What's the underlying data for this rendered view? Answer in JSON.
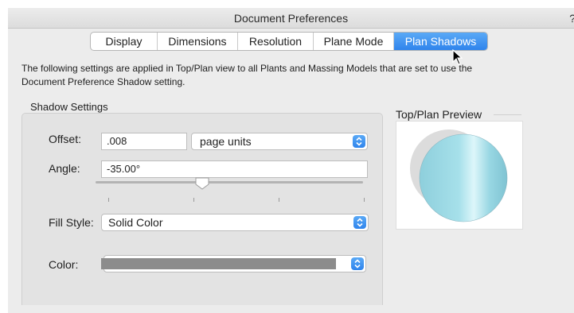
{
  "window": {
    "title": "Document Preferences",
    "help": "?"
  },
  "tabs": [
    {
      "label": "Display",
      "active": false
    },
    {
      "label": "Dimensions",
      "active": false
    },
    {
      "label": "Resolution",
      "active": false
    },
    {
      "label": "Plane Mode",
      "active": false
    },
    {
      "label": "Plan Shadows",
      "active": true
    }
  ],
  "description": "The following settings are applied in Top/Plan view to all Plants and Massing Models that are set to use the Document Preference Shadow setting.",
  "shadow_settings": {
    "group_label": "Shadow Settings",
    "offset": {
      "label": "Offset:",
      "value": ".008",
      "units": "page units"
    },
    "angle": {
      "label": "Angle:",
      "value": "-35.00°",
      "slider_fraction": 0.4
    },
    "fill_style": {
      "label": "Fill Style:",
      "value": "Solid Color"
    },
    "color": {
      "label": "Color:",
      "swatch": "#8c8c8c"
    }
  },
  "preview": {
    "label": "Top/Plan Preview",
    "shadow_color": "#dcdcdc",
    "object_color": "#a6e0ea"
  },
  "colors": {
    "accent": "#2f84ec",
    "window_bg": "#ececec",
    "group_bg": "#e3e3e3"
  }
}
